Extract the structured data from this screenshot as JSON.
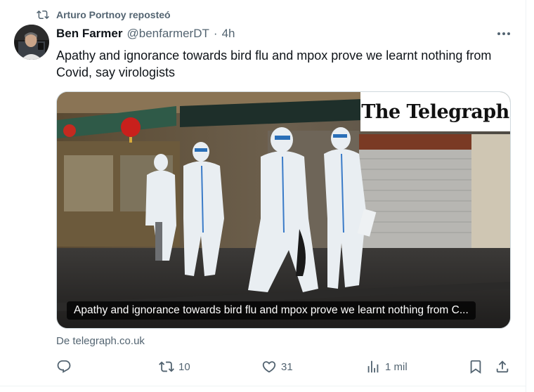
{
  "repost": {
    "text": "Arturo Portnoy reposteó",
    "icon": "repost-icon"
  },
  "tweet": {
    "author_name": "Ben Farmer",
    "author_handle": "@benfarmerDT",
    "separator": "·",
    "time": "4h",
    "text": "Apathy and ignorance towards bird flu and mpox prove we learnt nothing from Covid, say virologists"
  },
  "card": {
    "publisher_logo": "The Telegraph",
    "caption": "Apathy and ignorance towards bird flu and mpox prove we learnt nothing from C...",
    "source": "De telegraph.co.uk"
  },
  "actions": {
    "reply": {
      "icon": "reply-icon",
      "count": ""
    },
    "repost": {
      "icon": "repost-icon",
      "count": "10"
    },
    "like": {
      "icon": "heart-icon",
      "count": "31"
    },
    "views": {
      "icon": "views-icon",
      "count": "1 mil"
    },
    "bookmark": {
      "icon": "bookmark-icon"
    },
    "share": {
      "icon": "share-icon"
    }
  },
  "colors": {
    "text": "#0f1419",
    "secondary": "#536471",
    "border": "#cfd9de"
  }
}
